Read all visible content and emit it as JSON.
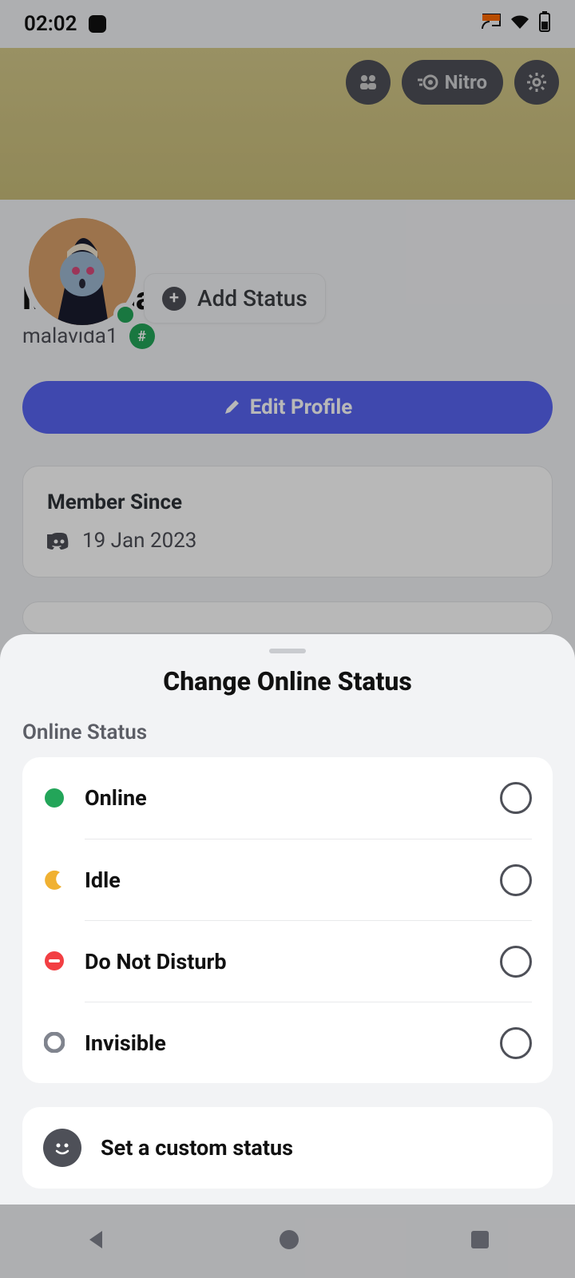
{
  "statusBar": {
    "time": "02:02"
  },
  "header": {
    "nitroLabel": "Nitro"
  },
  "profile": {
    "addStatusLabel": "Add Status",
    "displayName": "Malavida",
    "username": "malavida1",
    "editProfileLabel": "Edit Profile",
    "memberSinceTitle": "Member Since",
    "memberSinceDate": "19 Jan 2023"
  },
  "sheet": {
    "title": "Change Online Status",
    "sectionLabel": "Online Status",
    "options": [
      {
        "label": "Online"
      },
      {
        "label": "Idle"
      },
      {
        "label": "Do Not Disturb"
      },
      {
        "label": "Invisible"
      }
    ],
    "customStatusLabel": "Set a custom status"
  }
}
